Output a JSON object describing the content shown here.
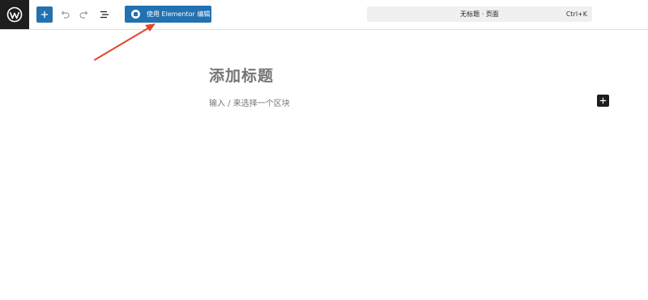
{
  "toolbar": {
    "elementor_button_label": "使用 Elementor 编辑",
    "document_title": "无标题 · 页面",
    "shortcut": "Ctrl+K",
    "icons": {
      "logo": "wordpress-logo-icon",
      "add": "plus-icon",
      "undo": "undo-icon",
      "redo": "redo-icon",
      "outline": "list-view-icon",
      "elementor": "elementor-icon"
    }
  },
  "editor": {
    "title_placeholder": "添加标题",
    "block_placeholder": "输入 / 来选择一个区块"
  },
  "colors": {
    "accent": "#2271b1",
    "dark": "#1e1e1e",
    "annotation": "#e5452e"
  }
}
